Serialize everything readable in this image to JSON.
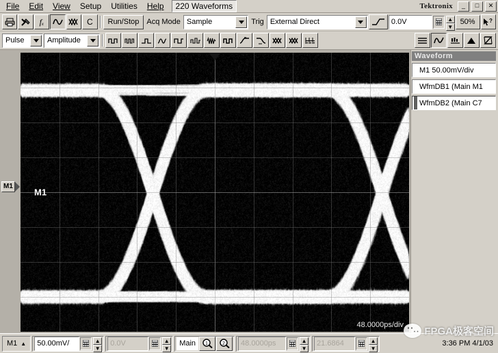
{
  "window": {
    "brand": "Tektronix",
    "waveform_count": "220 Waveforms",
    "minimize_label": "_",
    "maximize_label": "□",
    "close_label": "✕"
  },
  "menubar": {
    "items": [
      {
        "label": "File"
      },
      {
        "label": "Edit"
      },
      {
        "label": "View"
      },
      {
        "label": "Setup"
      },
      {
        "label": "Utilities"
      },
      {
        "label": "Help"
      }
    ]
  },
  "toolbar1": {
    "icons": [
      {
        "name": "print-icon"
      },
      {
        "name": "tools-icon"
      },
      {
        "name": "fx-icon",
        "label": "fₓ"
      },
      {
        "name": "waveform-icon"
      },
      {
        "name": "eye-diagram-icon"
      },
      {
        "name": "cursor-c-icon",
        "label": "C"
      }
    ],
    "run_stop_label": "Run/Stop",
    "acq_mode_label": "Acq Mode",
    "acq_mode_value": "Sample",
    "trig_label": "Trig",
    "trig_source_value": "External Direct",
    "trig_slope_icon": "rising-edge-icon",
    "trig_level_value": "0.0V",
    "level_50_label": "50%",
    "help_cursor_label": "?"
  },
  "toolbar2": {
    "measure_category": "Pulse",
    "measure_type": "Amplitude",
    "measure_icons": [
      {
        "name": "meas-period-icon"
      },
      {
        "name": "meas-frequency-icon"
      },
      {
        "name": "meas-pulse-width-icon"
      },
      {
        "name": "meas-rise-time-icon"
      },
      {
        "name": "meas-fall-time-icon"
      },
      {
        "name": "meas-duty-cycle-icon"
      },
      {
        "name": "meas-burst-width-icon"
      },
      {
        "name": "meas-amplitude-icon"
      },
      {
        "name": "meas-overshoot-icon"
      },
      {
        "name": "meas-undershoot-icon"
      },
      {
        "name": "meas-eye-height-icon"
      },
      {
        "name": "meas-eye-width-icon"
      },
      {
        "name": "meas-jitter-icon"
      }
    ],
    "view_icons": [
      {
        "name": "list-view-icon"
      },
      {
        "name": "waveform-view-icon"
      },
      {
        "name": "histogram-view-icon"
      },
      {
        "name": "mask-view-icon"
      },
      {
        "name": "eye-measure-icon"
      }
    ]
  },
  "display": {
    "channel_marker": "M1",
    "trace_label": "M1",
    "time_per_div": "48.0000ps/div"
  },
  "sidepanel": {
    "title": "Waveform",
    "items": [
      {
        "label": "M1 50.00mV/div",
        "selected": false
      },
      {
        "label": "WfmDB1 (Main M1",
        "selected": false
      },
      {
        "label": "WfmDB2 (Main C7",
        "selected": true
      }
    ]
  },
  "statusbar": {
    "channel_label": "M1",
    "vertical_scale": "50.00mV/",
    "vertical_offset": "0.0V",
    "timebase_label": "Main",
    "zoom1_label": "1",
    "zoom2_label": "2",
    "horizontal_scale": "48.0000ps",
    "horizontal_position": "21.6864",
    "clock": "3:36 PM 4/1/03"
  },
  "watermark": {
    "text": "FPGA极客空间"
  }
}
